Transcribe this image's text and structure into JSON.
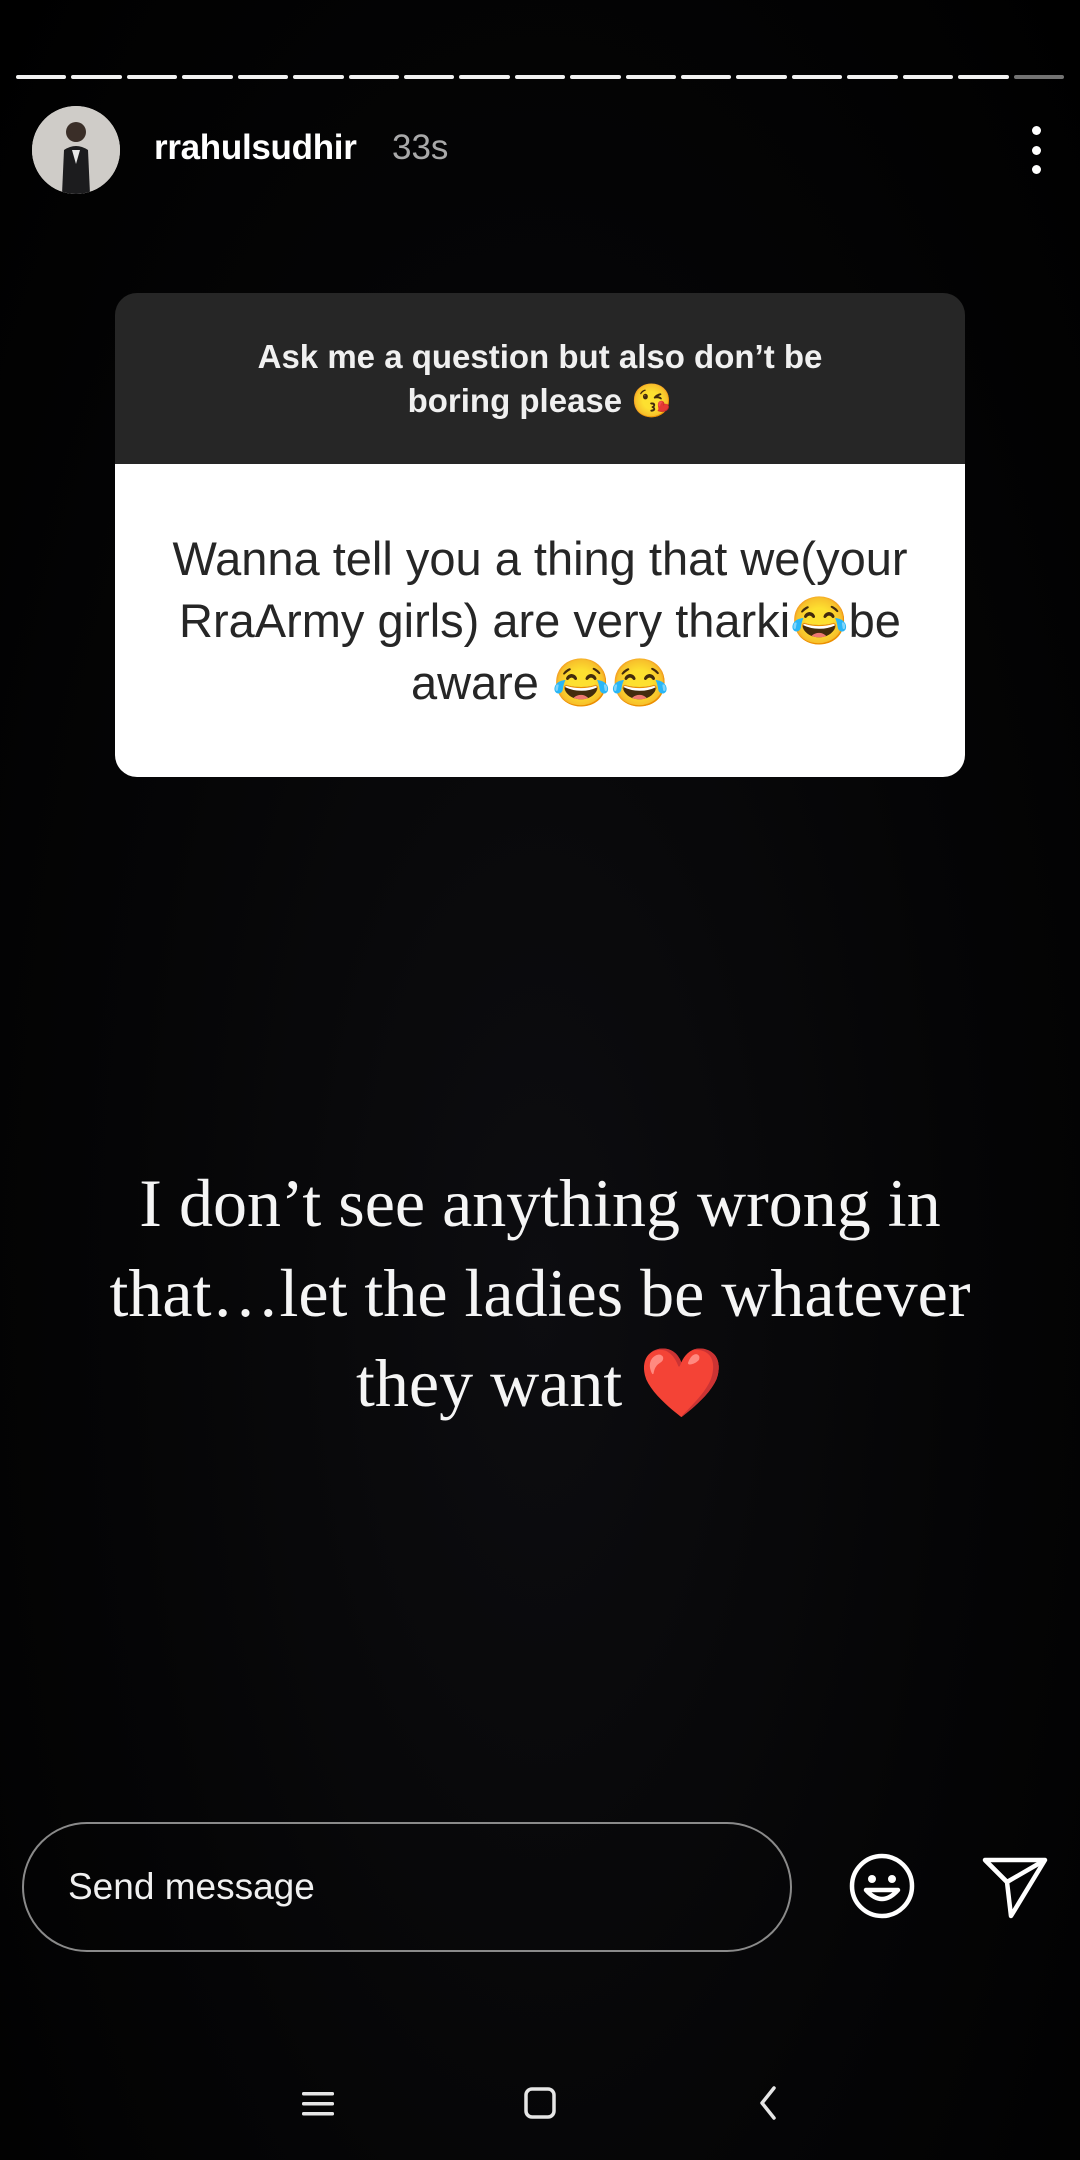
{
  "story": {
    "progress_segments_total": 19,
    "progress_segments_viewed": 18
  },
  "header": {
    "username": "rrahulsudhir",
    "time_ago": "33s"
  },
  "question_card": {
    "prompt": "Ask me a question but also don’t be boring please 😘",
    "answer": "Wanna tell you a thing that we(your RraArmy girls) are very tharki😂be aware 😂😂"
  },
  "reply": {
    "text": "I don’t see anything wrong in that…let the ladies be whatever they want ❤️"
  },
  "composer": {
    "placeholder": "Send message"
  },
  "icons": {
    "more": "more-vertical-icon",
    "emoji": "smiley-icon",
    "send": "send-paper-plane-icon",
    "nav_menu": "menu-icon",
    "nav_home": "square-home-icon",
    "nav_back": "chevron-left-icon"
  },
  "colors": {
    "background": "#000000",
    "card_header": "#262626",
    "card_body": "#ffffff",
    "muted_text": "#a9a9a9",
    "heart": "#e0202a"
  }
}
